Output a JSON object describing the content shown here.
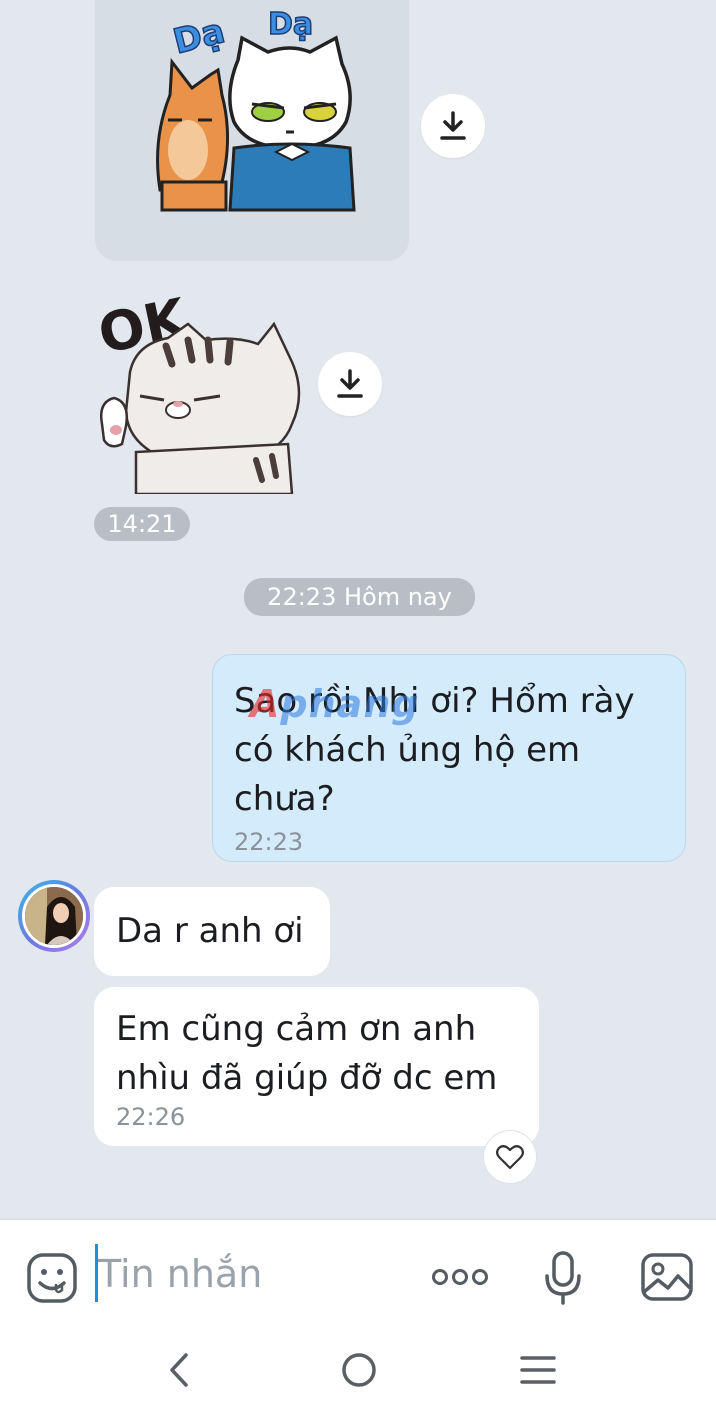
{
  "stickers": [
    {
      "name": "cats-da-da",
      "text_left": "Dạ",
      "text_right": "Dạ"
    },
    {
      "name": "cat-ok",
      "text": "OK"
    }
  ],
  "sticker_time": "14:21",
  "date_separator": "22:23 Hôm nay",
  "messages": {
    "outgoing": {
      "text": "Sao rồi Nhi ơi? Hổm rày có khách ủng hộ em chưa?",
      "time": "22:23"
    },
    "incoming": [
      {
        "text": "Da r anh ơi"
      },
      {
        "text": "Em cũng cảm ơn anh nhìu đã giúp đỡ dc em",
        "time": "22:26"
      }
    ]
  },
  "watermark": {
    "part1": "A",
    "part2": "phang"
  },
  "composer": {
    "placeholder": "Tin nhắn",
    "icons": [
      "emoji-icon",
      "more-icon",
      "microphone-icon",
      "image-icon"
    ]
  },
  "nav": {
    "icons": [
      "back-icon",
      "home-icon",
      "recent-apps-icon"
    ]
  },
  "colors": {
    "background": "#e3e8ef",
    "outgoing_bubble": "#d4ebfb",
    "incoming_bubble": "#ffffff",
    "accent": "#1c8fe3"
  }
}
